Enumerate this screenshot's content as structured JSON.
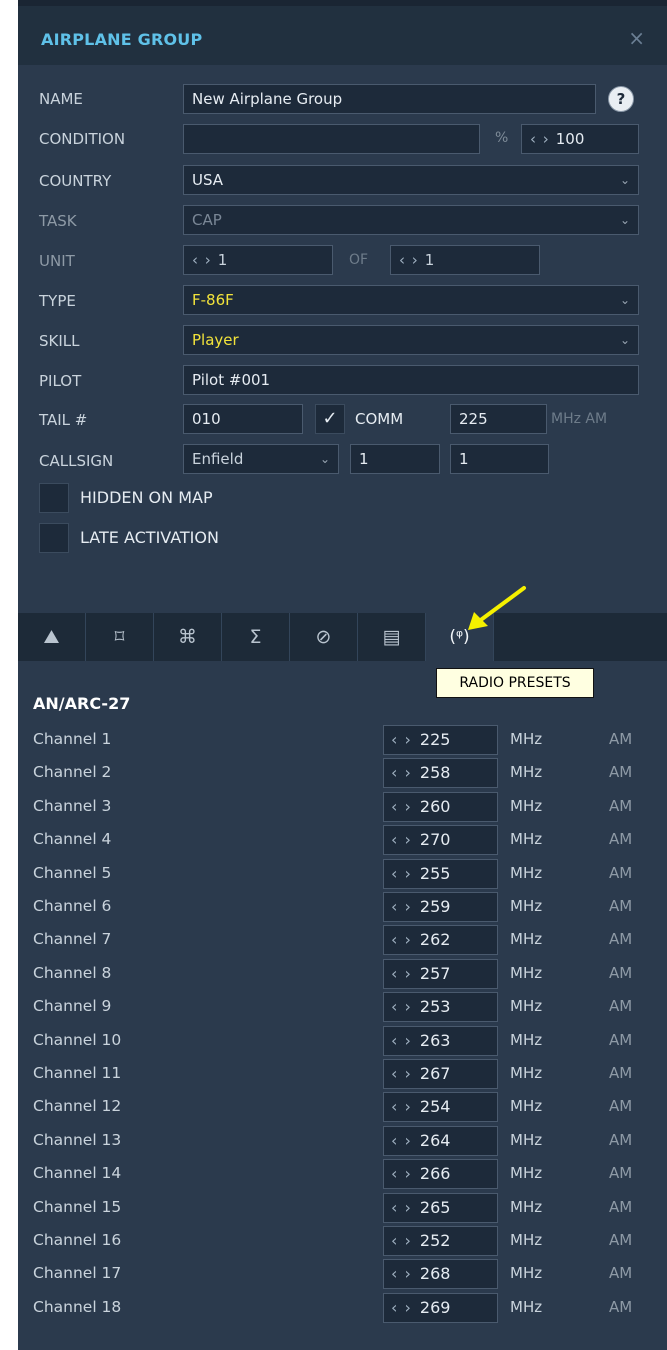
{
  "window": {
    "title": "AIRPLANE GROUP",
    "close_icon": "close-icon"
  },
  "form": {
    "name_label": "NAME",
    "name_value": "New Airplane Group",
    "help": "?",
    "condition_label": "CONDITION",
    "condition_value": "",
    "percent": "%",
    "condition_pct": "100",
    "country_label": "COUNTRY",
    "country_value": "USA",
    "task_label": "TASK",
    "task_value": "CAP",
    "unit_label": "UNIT",
    "unit_value": "1",
    "of_label": "OF",
    "unit_of_value": "1",
    "type_label": "TYPE",
    "type_value": "F-86F",
    "skill_label": "SKILL",
    "skill_value": "Player",
    "pilot_label": "PILOT",
    "pilot_value": "Pilot #001",
    "tail_label": "TAIL #",
    "tail_value": "010",
    "comm_label": "COMM",
    "comm_value": "225",
    "comm_unit": "MHz AM",
    "callsign_label": "CALLSIGN",
    "callsign_value": "Enfield",
    "callsign_num1": "1",
    "callsign_num2": "1",
    "hidden_label": "HIDDEN ON MAP",
    "late_label": "LATE ACTIVATION"
  },
  "tabs": [
    {
      "icon": "waypoints-icon",
      "glyph": "⛰"
    },
    {
      "icon": "target-icon",
      "glyph": "⌑"
    },
    {
      "icon": "command-icon",
      "glyph": "⌘"
    },
    {
      "icon": "sigma-icon",
      "glyph": "Σ"
    },
    {
      "icon": "no-icon",
      "glyph": "⊘"
    },
    {
      "icon": "payload-icon",
      "glyph": "▤"
    },
    {
      "icon": "radio-antenna-icon",
      "glyph": "(ᵠ)"
    }
  ],
  "tooltip": "RADIO PRESETS",
  "radio": {
    "title": "AN/ARC-27",
    "unit_mhz": "MHz",
    "mod": "AM",
    "channels": [
      {
        "label": "Channel 1",
        "value": "225"
      },
      {
        "label": "Channel 2",
        "value": "258"
      },
      {
        "label": "Channel 3",
        "value": "260"
      },
      {
        "label": "Channel 4",
        "value": "270"
      },
      {
        "label": "Channel 5",
        "value": "255"
      },
      {
        "label": "Channel 6",
        "value": "259"
      },
      {
        "label": "Channel 7",
        "value": "262"
      },
      {
        "label": "Channel 8",
        "value": "257"
      },
      {
        "label": "Channel 9",
        "value": "253"
      },
      {
        "label": "Channel 10",
        "value": "263"
      },
      {
        "label": "Channel 11",
        "value": "267"
      },
      {
        "label": "Channel 12",
        "value": "254"
      },
      {
        "label": "Channel 13",
        "value": "264"
      },
      {
        "label": "Channel 14",
        "value": "266"
      },
      {
        "label": "Channel 15",
        "value": "265"
      },
      {
        "label": "Channel 16",
        "value": "252"
      },
      {
        "label": "Channel 17",
        "value": "268"
      },
      {
        "label": "Channel 18",
        "value": "269"
      }
    ]
  },
  "colors": {
    "accent": "#5fc1e8",
    "highlight": "#f2e33a",
    "panel": "#2b3a4d",
    "annotation_arrow": "#f5f000"
  }
}
